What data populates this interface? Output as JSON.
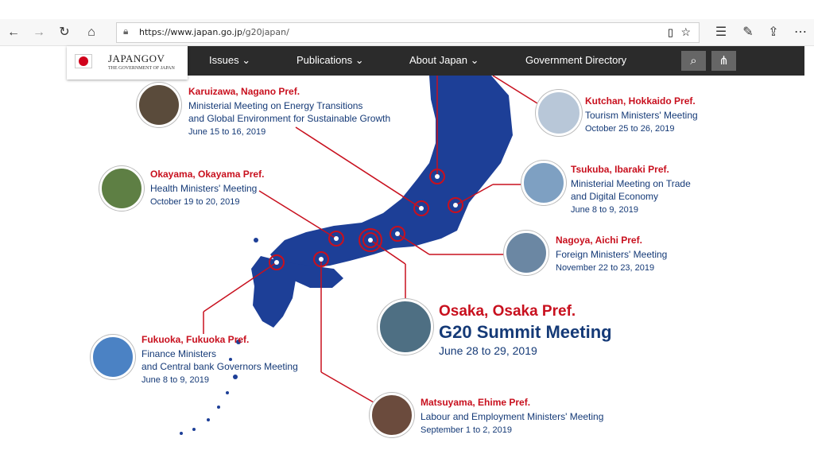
{
  "browser": {
    "url_host": "https://www.japan.go.jp",
    "url_path": "/g20japan/"
  },
  "site": {
    "logo_title": "JAPANGOV",
    "logo_subtitle": "THE GOVERNMENT OF JAPAN",
    "nav": [
      "Issues",
      "Publications",
      "About Japan",
      "Government Directory"
    ]
  },
  "events": [
    {
      "city": "Karuizawa, Nagano Pref.",
      "meeting": [
        "Ministerial Meeting on Energy Transitions",
        "and Global Environment for Sustainable Growth"
      ],
      "date": "June 15 to 16, 2019"
    },
    {
      "city": "Kutchan, Hokkaido Pref.",
      "meeting": [
        "Tourism Ministers' Meeting"
      ],
      "date": "October 25 to 26, 2019"
    },
    {
      "city": "Okayama, Okayama Pref.",
      "meeting": [
        "Health Ministers' Meeting"
      ],
      "date": "October 19 to 20, 2019"
    },
    {
      "city": "Tsukuba, Ibaraki Pref.",
      "meeting": [
        "Ministerial Meeting on Trade",
        "and Digital Economy"
      ],
      "date": "June 8 to 9, 2019"
    },
    {
      "city": "Nagoya, Aichi Pref.",
      "meeting": [
        "Foreign Ministers' Meeting"
      ],
      "date": "November 22 to 23, 2019"
    },
    {
      "city": "Osaka, Osaka Pref.",
      "meeting": [
        "G20 Summit Meeting"
      ],
      "date": "June 28 to 29, 2019"
    },
    {
      "city": "Fukuoka, Fukuoka Pref.",
      "meeting": [
        "Finance Ministers",
        "and Central bank Governors Meeting"
      ],
      "date": "June 8 to 9, 2019"
    },
    {
      "city": "Matsuyama, Ehime Pref.",
      "meeting": [
        "Labour and Employment Ministers' Meeting"
      ],
      "date": "September 1 to 2, 2019"
    }
  ],
  "colors": {
    "accent": "#c8101e",
    "navy": "#153a77",
    "map": "#1d3f97",
    "nav_bg": "#2b2b2b"
  }
}
